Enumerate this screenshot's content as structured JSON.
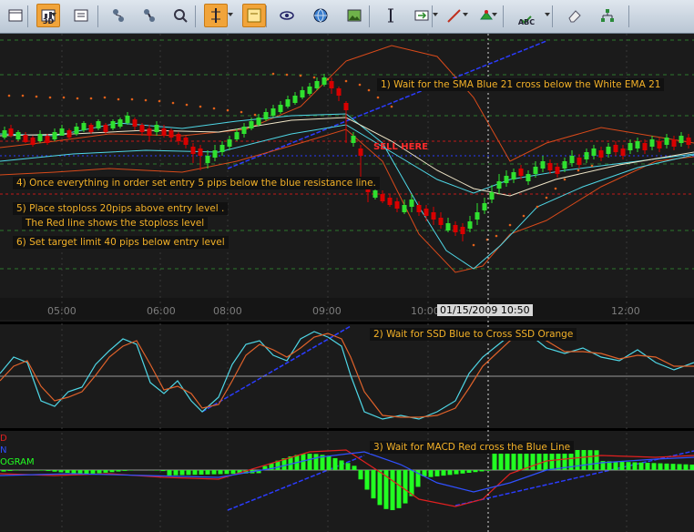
{
  "toolbar": {
    "buttons": [
      {
        "name": "window-icon",
        "label": "",
        "active": false
      },
      {
        "name": "3d-candle-icon",
        "label": "3D",
        "active": true
      },
      {
        "name": "chart-properties-icon",
        "label": "",
        "active": false
      },
      {
        "name": "compare-icon",
        "label": "",
        "active": false
      },
      {
        "name": "link-icon",
        "label": "",
        "active": false
      },
      {
        "name": "zoom-icon",
        "label": "",
        "active": false
      },
      {
        "name": "crosshair-icon",
        "label": "",
        "active": true
      },
      {
        "name": "note-icon",
        "label": "",
        "active": true
      },
      {
        "name": "eye-icon",
        "label": "",
        "active": false
      },
      {
        "name": "globe-icon",
        "label": "",
        "active": false
      },
      {
        "name": "image-icon",
        "label": "",
        "active": false
      },
      {
        "name": "text-cursor-icon",
        "label": "",
        "active": false
      },
      {
        "name": "export-icon",
        "label": "",
        "active": false
      },
      {
        "name": "draw-line-icon",
        "label": "",
        "active": false
      },
      {
        "name": "color-picker-icon",
        "label": "",
        "active": false
      },
      {
        "name": "spell-check-icon",
        "label": "ABC",
        "active": false
      },
      {
        "name": "eraser-icon",
        "label": "",
        "active": false
      },
      {
        "name": "tree-icon",
        "label": "",
        "active": false
      }
    ]
  },
  "annotations": {
    "note1": "1) Wait for the SMA  Blue 21 cross below the White EMA 21",
    "sell_here": "SELL HERE",
    "note4": "4) Once everything in order set entry 5 pips below  the blue  resistance line.",
    "note5a": "5) Place stoploss 20pips above entry level .",
    "note5b": "The Red line shows the stoploss level",
    "note6": "6) Set target limit 40 pips below entry level",
    "note2": "2) Wait for SSD Blue to Cross SSD Orange",
    "note3": "3) Wait for MACD Red cross the Blue Line"
  },
  "time_axis": {
    "labels": [
      "05:00",
      "06:00",
      "08:00",
      "09:00",
      "10:00",
      "12:00"
    ],
    "cursor": "01/15/2009 10:50"
  },
  "macd_legend": {
    "items": [
      {
        "text": "D",
        "color": "#e02020"
      },
      {
        "text": "N",
        "color": "#3050ff"
      },
      {
        "text": "OGRAM",
        "color": "#22ff22"
      }
    ]
  },
  "colors": {
    "background": "#1b1b1b",
    "up": "#2fe02f",
    "down": "#d80000",
    "sma_blue": "#4fd7e6",
    "ema_white": "#f0e6c8",
    "bollinger": "#d94a1a",
    "trend": "#2b3cff",
    "ssd_blue": "#4fd7e6",
    "ssd_orange": "#e0622a",
    "grid": "#3a3a3a"
  }
}
